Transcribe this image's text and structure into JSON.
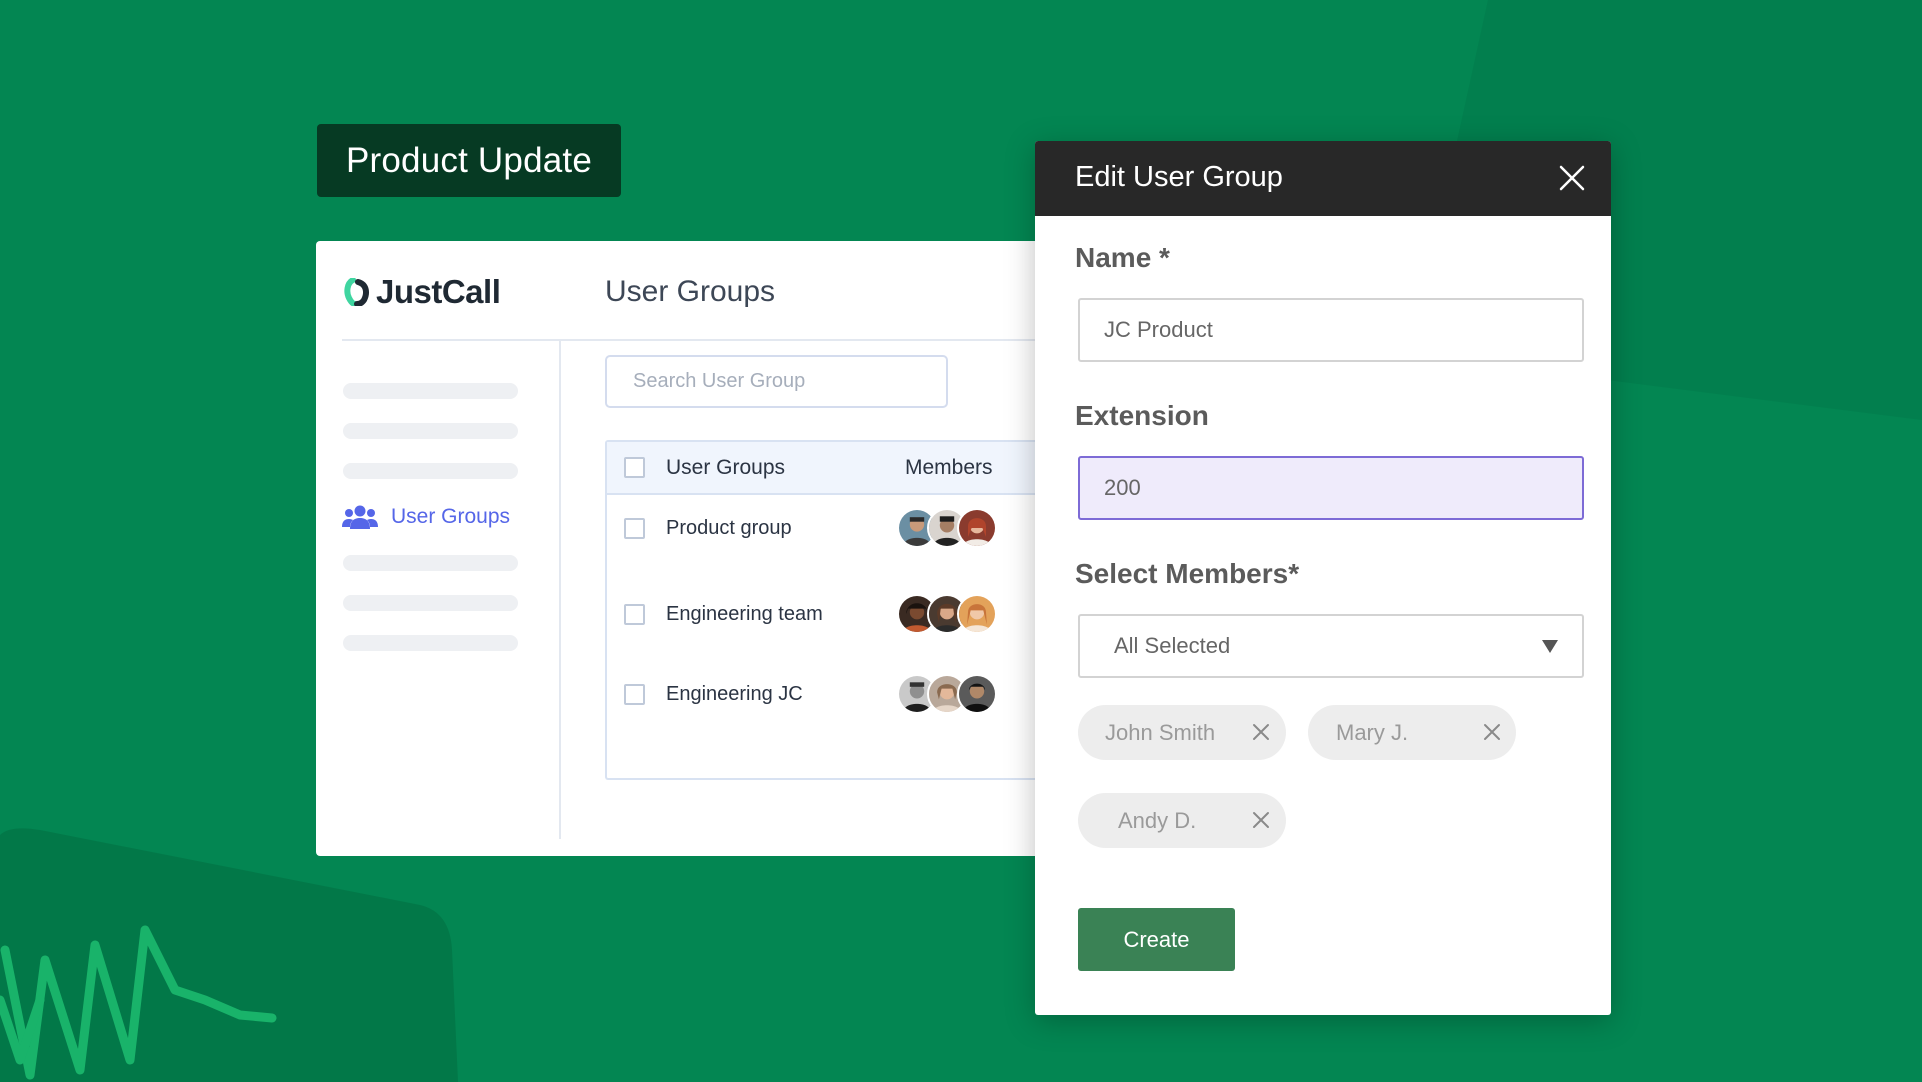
{
  "banner": {
    "label": "Product Update"
  },
  "app": {
    "brand": "JustCall",
    "page_title": "User Groups",
    "sidebar": {
      "active_item": "User Groups"
    },
    "search": {
      "placeholder": "Search User Group"
    },
    "table": {
      "columns": [
        "User Groups",
        "Members"
      ],
      "rows": [
        {
          "name": "Product group"
        },
        {
          "name": "Engineering team"
        },
        {
          "name": "Engineering JC"
        }
      ]
    }
  },
  "modal": {
    "title": "Edit User Group",
    "name_label": "Name *",
    "name_value": "JC Product",
    "extension_label": "Extension",
    "extension_value": "200",
    "members_label": "Select Members*",
    "members_value": "All Selected",
    "chips": [
      "John Smith",
      "Mary J.",
      "Andy D."
    ],
    "create_label": "Create"
  },
  "colors": {
    "background": "#038652",
    "accent_blue": "#5566e8",
    "create_button": "#3a8255",
    "modal_header": "#282828"
  }
}
